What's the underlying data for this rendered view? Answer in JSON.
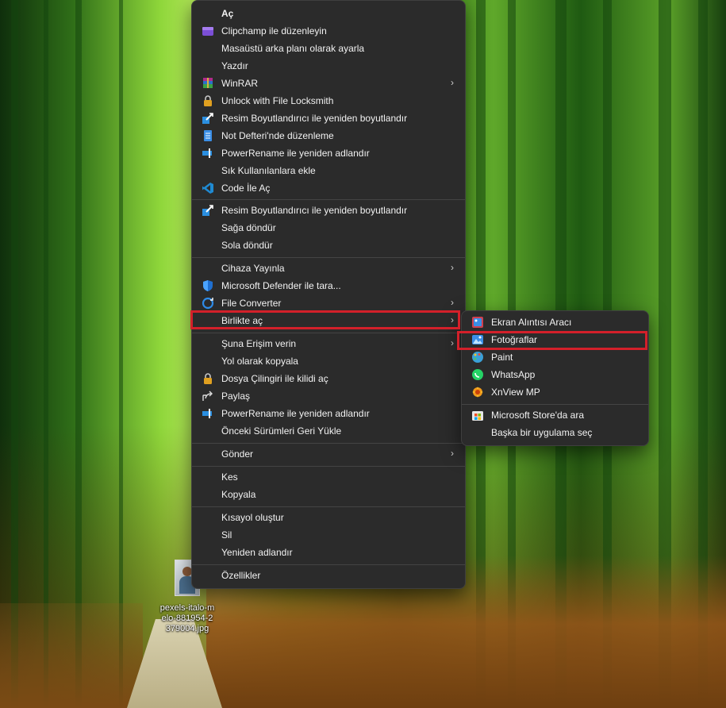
{
  "main_menu": {
    "group1": [
      {
        "label": "Aç",
        "icon": "none",
        "bold": true
      },
      {
        "label": "Clipchamp ile düzenleyin",
        "icon": "clipchamp-icon"
      },
      {
        "label": "Masaüstü arka planı olarak ayarla",
        "icon": "none"
      },
      {
        "label": "Yazdır",
        "icon": "none"
      },
      {
        "label": "WinRAR",
        "icon": "winrar-icon",
        "submenu": true
      },
      {
        "label": "Unlock with File Locksmith",
        "icon": "lock-icon"
      },
      {
        "label": "Resim Boyutlandırıcı ile yeniden boyutlandır",
        "icon": "image-resizer-icon"
      },
      {
        "label": "Not Defteri'nde düzenleme",
        "icon": "notepad-icon"
      },
      {
        "label": "PowerRename ile yeniden adlandır",
        "icon": "powerrename-icon"
      },
      {
        "label": "Sık Kullanılanlara ekle",
        "icon": "none"
      },
      {
        "label": "Code İle Aç",
        "icon": "vscode-icon"
      }
    ],
    "group2": [
      {
        "label": "Resim Boyutlandırıcı ile yeniden boyutlandır",
        "icon": "image-resizer-icon"
      },
      {
        "label": "Sağa döndür",
        "icon": "none"
      },
      {
        "label": "Sola döndür",
        "icon": "none"
      }
    ],
    "group3": [
      {
        "label": "Cihaza Yayınla",
        "icon": "none",
        "submenu": true
      },
      {
        "label": "Microsoft Defender ile tara...",
        "icon": "defender-shield-icon"
      },
      {
        "label": "File Converter",
        "icon": "file-converter-icon",
        "submenu": true
      },
      {
        "label": "Birlikte aç",
        "icon": "none",
        "submenu": true,
        "highlighted": true
      }
    ],
    "group4": [
      {
        "label": "Şuna Erişim verin",
        "icon": "none",
        "submenu": true
      },
      {
        "label": "Yol olarak kopyala",
        "icon": "none"
      },
      {
        "label": "Dosya Çilingiri ile kilidi aç",
        "icon": "lock-icon"
      },
      {
        "label": "Paylaş",
        "icon": "share-icon"
      },
      {
        "label": "PowerRename ile yeniden adlandır",
        "icon": "powerrename-icon"
      },
      {
        "label": "Önceki Sürümleri Geri Yükle",
        "icon": "none"
      }
    ],
    "group5": [
      {
        "label": "Gönder",
        "icon": "none",
        "submenu": true
      }
    ],
    "group6": [
      {
        "label": "Kes",
        "icon": "none"
      },
      {
        "label": "Kopyala",
        "icon": "none"
      }
    ],
    "group7": [
      {
        "label": "Kısayol oluştur",
        "icon": "none"
      },
      {
        "label": "Sil",
        "icon": "none"
      },
      {
        "label": "Yeniden adlandır",
        "icon": "none"
      }
    ],
    "group8": [
      {
        "label": "Özellikler",
        "icon": "none"
      }
    ]
  },
  "sub_menu": {
    "apps": [
      {
        "label": "Ekran Alıntısı Aracı",
        "icon": "snipping-tool-icon"
      },
      {
        "label": "Fotoğraflar",
        "icon": "photos-icon",
        "highlighted": true
      },
      {
        "label": "Paint",
        "icon": "paint-icon"
      },
      {
        "label": "WhatsApp",
        "icon": "whatsapp-icon"
      },
      {
        "label": "XnView MP",
        "icon": "xnview-icon"
      }
    ],
    "extra": [
      {
        "label": "Microsoft Store'da ara",
        "icon": "ms-store-icon"
      },
      {
        "label": "Başka bir uygulama seç",
        "icon": "none"
      }
    ]
  },
  "desktop_file": {
    "label": "pexels-italo-melo-881954-2379004.jpg"
  },
  "colors": {
    "menu_bg": "#2b2b2b",
    "highlight_border": "#d3202a",
    "text": "#f2f2f2"
  }
}
